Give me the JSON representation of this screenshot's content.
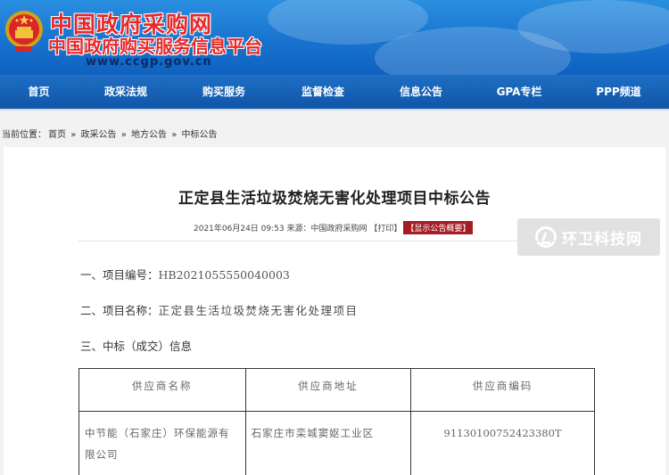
{
  "site": {
    "name_cn": "中国政府采购网",
    "subtitle": "中国政府购买服务信息平台",
    "url": "www.ccgp.gov.cn",
    "primary_color": "#1773cf",
    "accent_red": "#e8292a"
  },
  "nav": {
    "items": [
      {
        "label": "首页"
      },
      {
        "label": "政采法规"
      },
      {
        "label": "购买服务"
      },
      {
        "label": "监督检查"
      },
      {
        "label": "信息公告"
      },
      {
        "label": "GPA专栏"
      },
      {
        "label": "PPP频道"
      }
    ]
  },
  "breadcrumb": {
    "prefix": "当前位置：",
    "items": [
      "首页",
      "政采公告",
      "地方公告",
      "中标公告"
    ],
    "separator": "»"
  },
  "article": {
    "title": "正定县生活垃圾焚烧无害化处理项目中标公告",
    "meta": "2021年06月24日 09:53 来源：中国政府采购网 【打印】",
    "summary_badge": "【显示公告概要】",
    "project_number_label": "一、项目编号：",
    "project_number": "HB2021055550040003",
    "project_name_label": "二、项目名称：",
    "project_name": "正定县生活垃圾焚烧无害化处理项目",
    "section3_label": "三、中标（成交）信息",
    "table": {
      "headers": [
        "供应商名称",
        "供应商地址",
        "供应商编码"
      ],
      "rows": [
        [
          "中节能（石家庄）环保能源有限公司",
          "石家庄市栾城窦妪工业区",
          "91130100752423380T"
        ]
      ]
    }
  },
  "watermark": {
    "text": "环卫科技网"
  }
}
